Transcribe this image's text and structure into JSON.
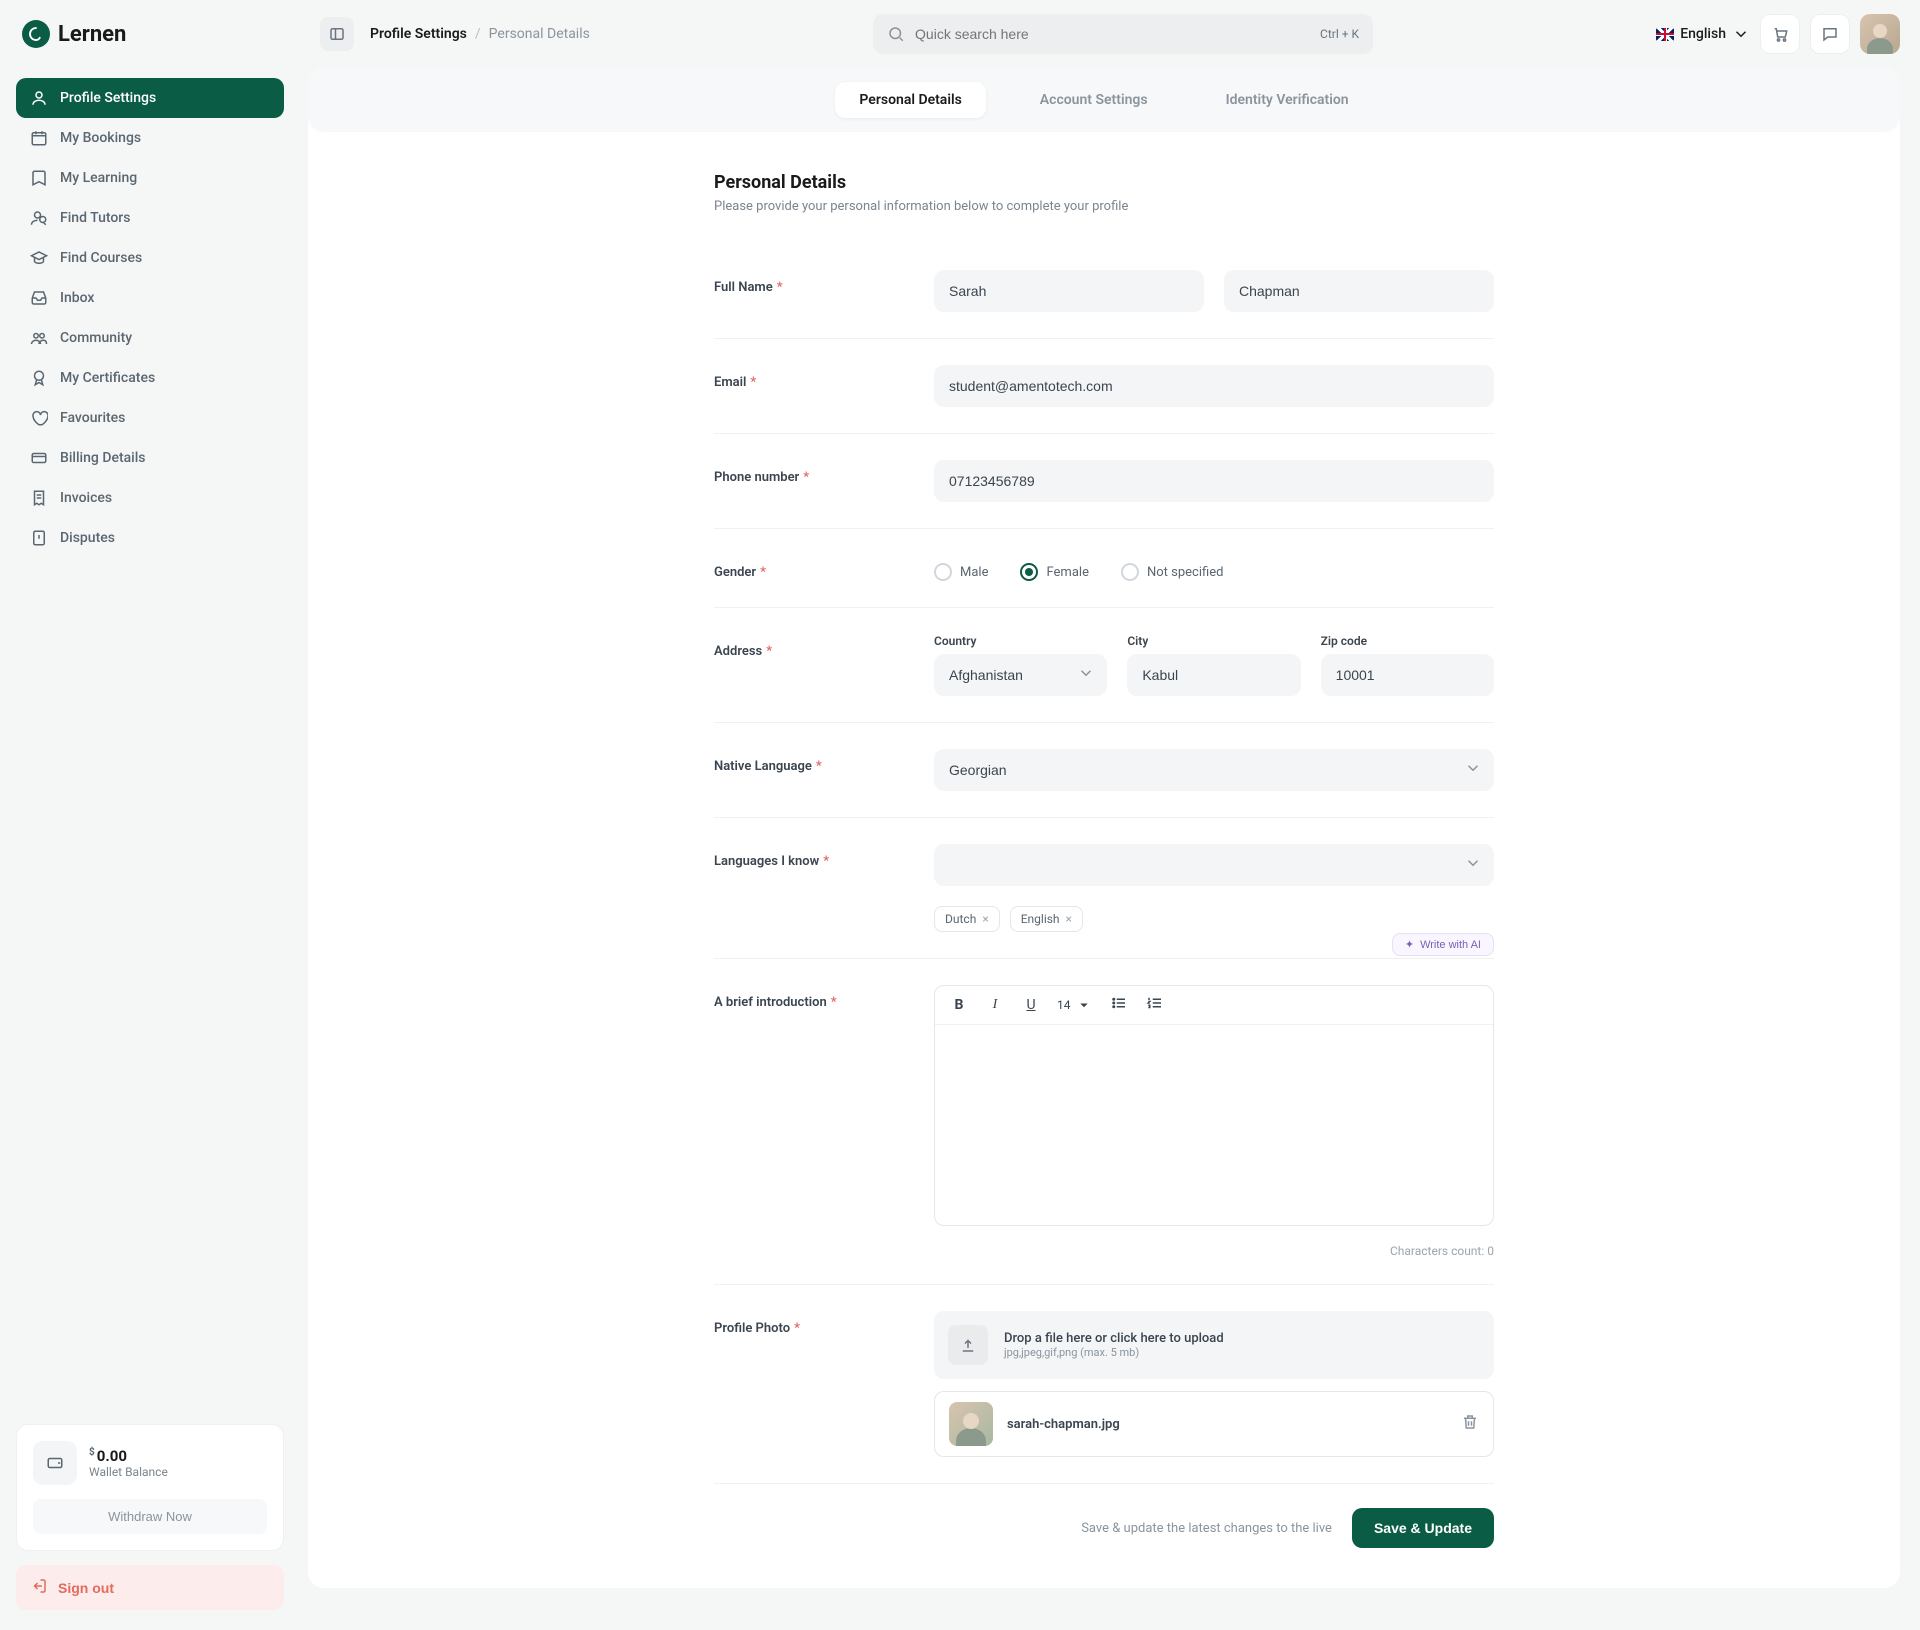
{
  "brand": "Lernen",
  "breadcrumb": {
    "a": "Profile Settings",
    "b": "Personal Details"
  },
  "search": {
    "placeholder": "Quick search here",
    "shortcut": "Ctrl + K"
  },
  "language": "English",
  "sidebar": {
    "items": [
      {
        "label": "Profile Settings"
      },
      {
        "label": "My Bookings"
      },
      {
        "label": "My Learning"
      },
      {
        "label": "Find Tutors"
      },
      {
        "label": "Find Courses"
      },
      {
        "label": "Inbox"
      },
      {
        "label": "Community"
      },
      {
        "label": "My Certificates"
      },
      {
        "label": "Favourites"
      },
      {
        "label": "Billing Details"
      },
      {
        "label": "Invoices"
      },
      {
        "label": "Disputes"
      }
    ]
  },
  "wallet": {
    "amount": "0.00",
    "currency": "$",
    "label": "Wallet Balance",
    "withdraw": "Withdraw Now"
  },
  "signout": "Sign out",
  "tabs": [
    {
      "label": "Personal Details"
    },
    {
      "label": "Account Settings"
    },
    {
      "label": "Identity Verification"
    }
  ],
  "section": {
    "title": "Personal Details",
    "subtitle": "Please provide your personal information below to complete your profile"
  },
  "labels": {
    "fullname": "Full Name",
    "email": "Email",
    "phone": "Phone number",
    "gender": "Gender",
    "address": "Address",
    "country": "Country",
    "city": "City",
    "zip": "Zip code",
    "native_lang": "Native Language",
    "languages": "Languages I know",
    "intro": "A brief introduction",
    "photo": "Profile Photo"
  },
  "values": {
    "first_name": "Sarah",
    "last_name": "Chapman",
    "email": "student@amentotech.com",
    "phone": "07123456789",
    "country": "Afghanistan",
    "city": "Kabul",
    "zip": "10001",
    "native_language": "Georgian"
  },
  "gender_options": {
    "male": "Male",
    "female": "Female",
    "unspecified": "Not specified"
  },
  "gender_selected": "female",
  "language_tags": [
    "Dutch",
    "English"
  ],
  "ai_button": "Write with AI",
  "editor": {
    "font_size": "14",
    "char_count_label": "Characters count:",
    "char_count": "0"
  },
  "upload": {
    "line1": "Drop a file here or click here to upload",
    "line2": "jpg,jpeg,gif,png (max. 5 mb)",
    "filename": "sarah-chapman.jpg"
  },
  "footer": {
    "hint": "Save & update the latest changes to the live",
    "button": "Save & Update"
  }
}
